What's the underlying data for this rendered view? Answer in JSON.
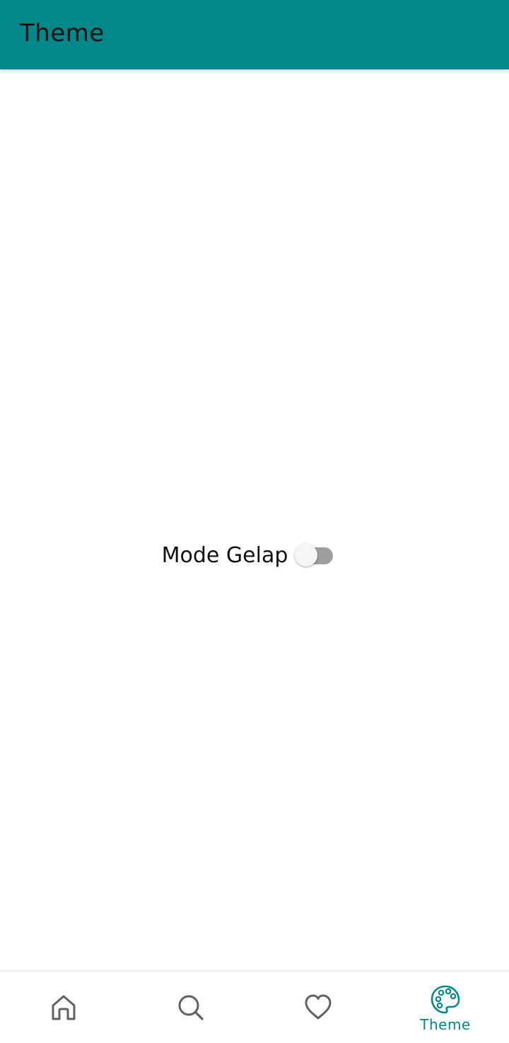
{
  "appbar": {
    "title": "Theme",
    "color": "#00888A"
  },
  "settings": {
    "dark_mode_label": "Mode Gelap",
    "dark_mode_enabled": false
  },
  "bottom_nav": {
    "active_color": "#00888A",
    "inactive_color": "#616161",
    "items": [
      {
        "icon": "home-icon",
        "label": "",
        "active": false
      },
      {
        "icon": "search-icon",
        "label": "",
        "active": false
      },
      {
        "icon": "heart-icon",
        "label": "",
        "active": false
      },
      {
        "icon": "palette-icon",
        "label": "Theme",
        "active": true
      }
    ]
  }
}
